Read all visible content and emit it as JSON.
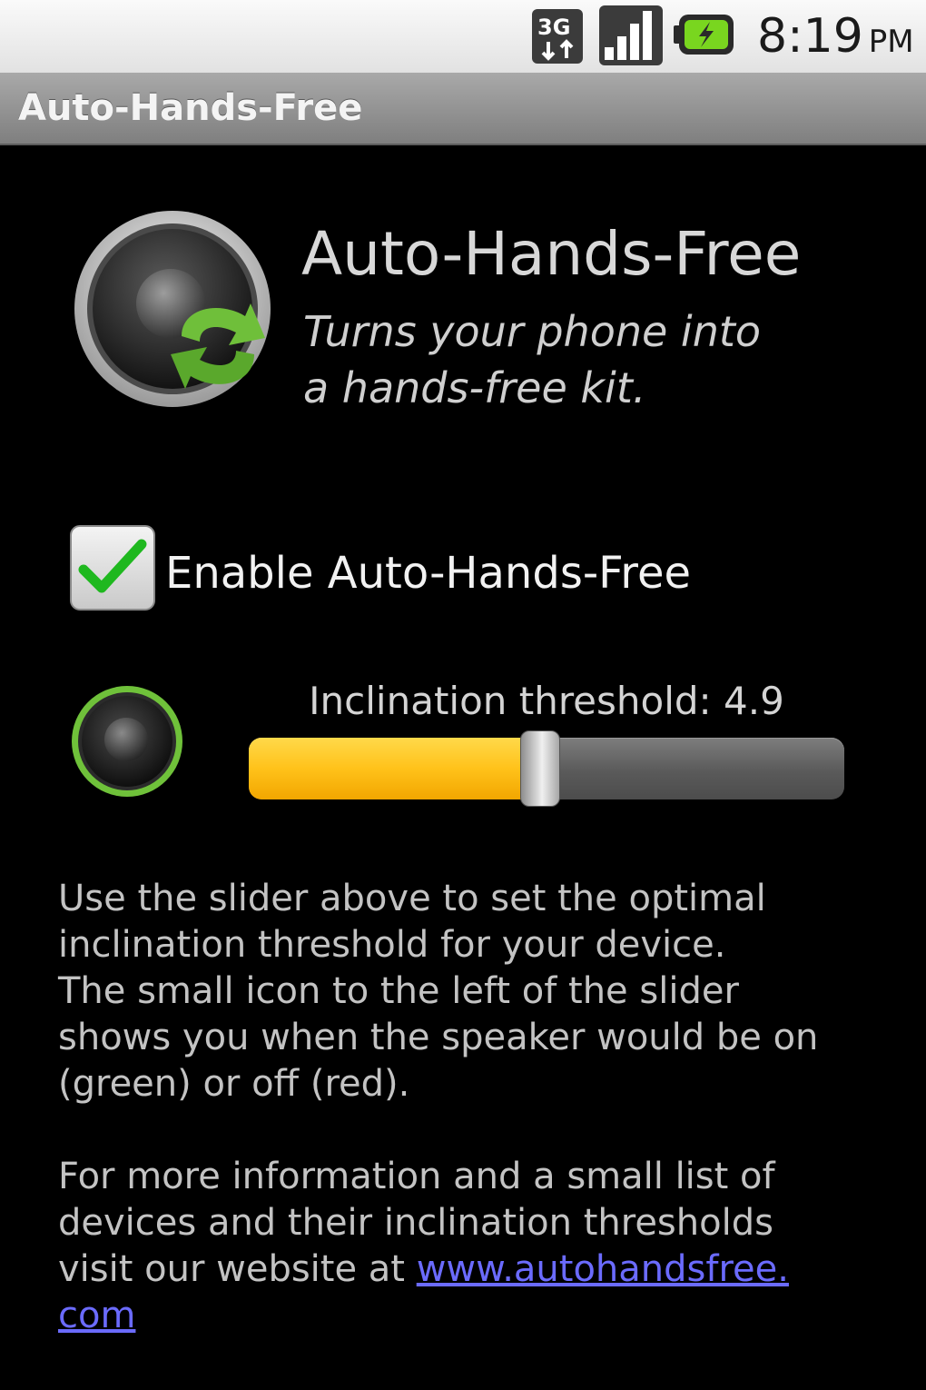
{
  "status_bar": {
    "network_type": "3G",
    "time": "8:19",
    "ampm": "PM",
    "icons": [
      "3g-data-icon",
      "signal-strength-icon",
      "battery-charging-icon"
    ]
  },
  "title_bar": {
    "title": "Auto-Hands-Free"
  },
  "header": {
    "app_name": "Auto-Hands-Free",
    "tagline_line1": "Turns your phone into",
    "tagline_line2": "a hands-free kit.",
    "icon": "speaker-refresh-icon"
  },
  "settings": {
    "enable_label": "Enable Auto-Hands-Free",
    "enable_checked": true,
    "speaker_status_icon": "speaker-icon",
    "speaker_status_color": "#6fc13a",
    "slider_label": "Inclination threshold: 4.9",
    "slider_fraction": 0.49,
    "slider_fill_color": "#ffc21a"
  },
  "description": {
    "para1_line1": "Use the slider above to set the optimal",
    "para1_line2": "inclination threshold for your device.",
    "para1_line3": "The small icon to the left of the slider",
    "para1_line4": "shows you when the speaker would be on",
    "para1_line5": "(green) or off (red).",
    "para2_line1": "For more information and a small list of",
    "para2_line2": "devices and their inclination thresholds",
    "para2_line3": "visit our website at ",
    "link_text_line1": "www.autohandsfree.",
    "link_text_line2": "com"
  },
  "colors": {
    "background": "#000000",
    "title_bar": "#8f8f8f",
    "link": "#6b6bff",
    "checkmark": "#2fcf2f"
  }
}
